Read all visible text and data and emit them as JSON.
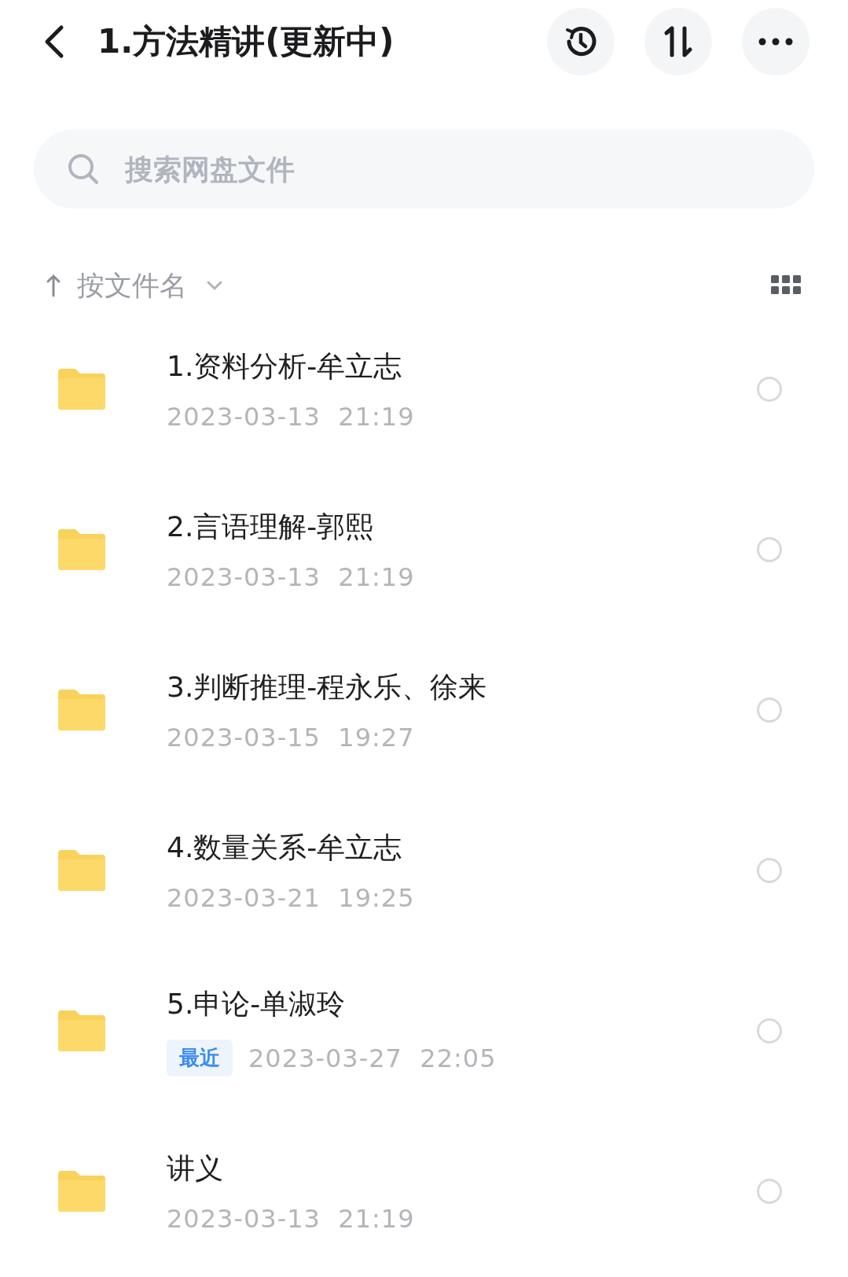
{
  "header": {
    "title": "1.方法精讲(更新中)"
  },
  "search": {
    "placeholder": "搜索网盘文件"
  },
  "sort": {
    "label": "按文件名"
  },
  "files": [
    {
      "name": "1.资料分析-牟立志",
      "date": "2023-03-13  21:19",
      "selected": false
    },
    {
      "name": "2.言语理解-郭熙",
      "date": "2023-03-13  21:19",
      "selected": false
    },
    {
      "name": "3.判断推理-程永乐、徐来",
      "date": "2023-03-15  19:27",
      "selected": false
    },
    {
      "name": "4.数量关系-牟立志",
      "date": "2023-03-21  19:25",
      "selected": false
    },
    {
      "name": "5.申论-单淑玲",
      "tag": "最近",
      "date": "2023-03-27  22:05",
      "selected": false
    },
    {
      "name": "讲义",
      "date": "2023-03-13  21:19",
      "selected": false
    }
  ]
}
